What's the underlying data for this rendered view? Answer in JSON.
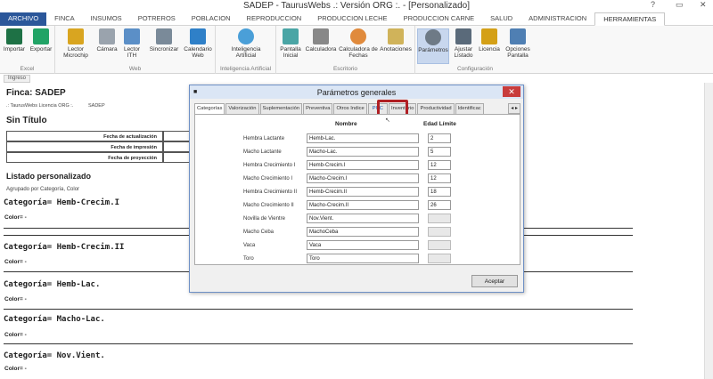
{
  "window": {
    "title": "SADEP - TaurusWebs .: Versión ORG :. - [Personalizado]",
    "controls": [
      "?",
      "▭",
      "✕"
    ]
  },
  "ribbon_tabs": [
    "ARCHIVO",
    "FINCA",
    "INSUMOS",
    "POTREROS",
    "POBLACION",
    "REPRODUCCION",
    "PRODUCCION LECHE",
    "PRODUCCION CARNE",
    "SALUD",
    "ADMINISTRACION",
    "HERRAMIENTAS"
  ],
  "ribbon": {
    "groups": {
      "excel": {
        "label": "Excel",
        "buttons": [
          "Importar",
          "Exportar"
        ]
      },
      "web": {
        "label": "Web",
        "buttons": [
          "Lector Microchip",
          "Cámara",
          "Lector ITH",
          "Sincronizar",
          "Calendario Web"
        ]
      },
      "ia": {
        "label": "Inteligencia Artificial",
        "buttons": [
          "Inteligencia Artificial"
        ]
      },
      "escritorio": {
        "label": "Escritorio",
        "buttons": [
          "Pantalla Inicial",
          "Calculadora",
          "Calculadora de Fechas",
          "Anotaciones"
        ]
      },
      "config": {
        "label": "Configuración",
        "buttons": [
          "Parámetros",
          "Ajustar Listado",
          "Licencia",
          "Opciones Pantalla"
        ]
      }
    }
  },
  "subtab": "Ingreso",
  "report": {
    "finca": "Finca: SADEP",
    "licencia": ".: TaurusWebs Licencia ORG :.",
    "sadep": "SADEP",
    "sin_titulo": "Sin Título",
    "fecha_actualizacion": "Fecha de actualización",
    "fecha_impresion": "Fecha de impresión",
    "fecha_proyeccion": "Fecha de proyección",
    "listado": "Listado personalizado",
    "agrupado": "Agrupado por Categoría, Color",
    "categorias": [
      {
        "cat": "Categoría= Hemb-Crecim.I",
        "color": "Color= -"
      },
      {
        "cat": "Categoría= Hemb-Crecim.II",
        "color": "Color= -"
      },
      {
        "cat": "Categoría= Hemb-Lac.",
        "color": "Color= -"
      },
      {
        "cat": "Categoría= Macho-Lac.",
        "color": "Color= -"
      },
      {
        "cat": "Categoría= Nov.Vient.",
        "color": "Color= -"
      }
    ]
  },
  "dialog": {
    "title": "Parámetros generales",
    "close": "✕",
    "tabs": [
      "Categorías",
      "Valorización",
      "Suplementación",
      "Preventiva",
      "Otros Indice",
      "PUC",
      "Inventario",
      "Productividad",
      "Identificac"
    ],
    "arrows": "◂ ▸",
    "col_nombre": "Nombre",
    "col_edad": "Edad Límite",
    "rows": [
      {
        "label": "Hembra Lactante",
        "nombre": "Hemb-Lac.",
        "edad": "2"
      },
      {
        "label": "Macho Lactante",
        "nombre": "Macho-Lac.",
        "edad": "5"
      },
      {
        "label": "Hembra Crecimiento I",
        "nombre": "Hemb-Crecim.I",
        "edad": "12"
      },
      {
        "label": "Macho Crecimiento I",
        "nombre": "Macho-Crecim.I",
        "edad": "12"
      },
      {
        "label": "Hembra Crecimiento II",
        "nombre": "Hemb-Crecim.II",
        "edad": "18"
      },
      {
        "label": "Macho Crecimiento II",
        "nombre": "Macho-Crecim.II",
        "edad": "26"
      },
      {
        "label": "Novilla de Vientre",
        "nombre": "Nov.Vient.",
        "edad": ""
      },
      {
        "label": "Macho Ceba",
        "nombre": "MachoCeba",
        "edad": ""
      },
      {
        "label": "Vaca",
        "nombre": "Vaca",
        "edad": ""
      },
      {
        "label": "Toro",
        "nombre": "Toro",
        "edad": ""
      }
    ],
    "ok_button": "Aceptar"
  },
  "colors": {
    "accent": "#2b579a",
    "highlight": "#b01f24",
    "close": "#c83c3c"
  }
}
